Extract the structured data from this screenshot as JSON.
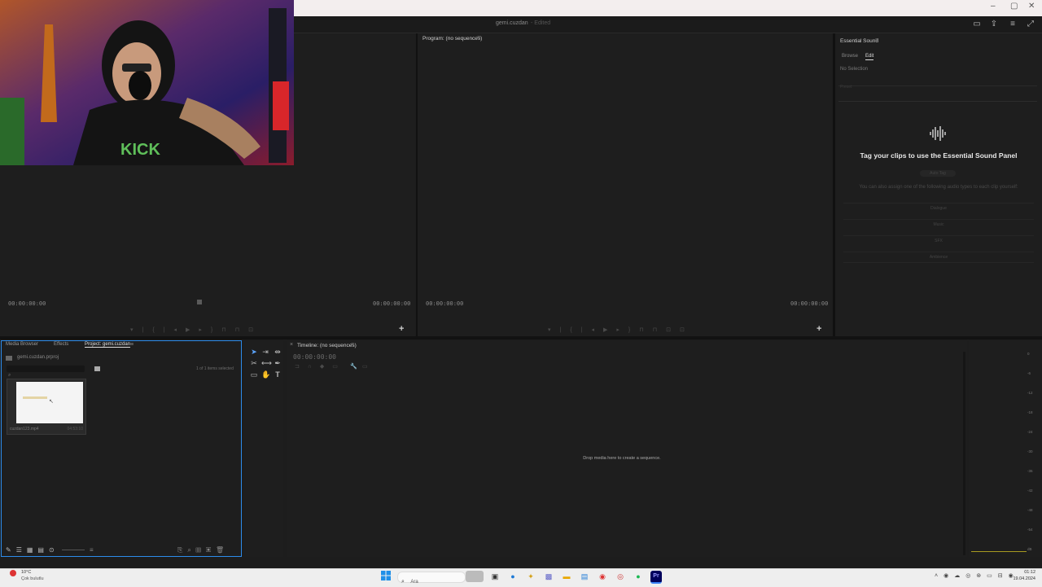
{
  "window": {
    "title": "gemi.cuzdan",
    "edited": "- Edited",
    "controls": [
      "–",
      "▢",
      "✕"
    ]
  },
  "header_icons": [
    "layout-icon",
    "share-icon",
    "menu-icon",
    "fullscreen-icon"
  ],
  "source_monitor": {
    "timecode_left": "00:00:00:00",
    "timecode_right": "00:00:00:00"
  },
  "program_monitor": {
    "title": "Program: (no sequences)",
    "timecode_left": "00:00:00:00",
    "timecode_right": "00:00:00:00"
  },
  "essential_sound": {
    "title": "Essential Sound",
    "tabs": [
      "Browse",
      "Edit"
    ],
    "active_tab": "Edit",
    "no_selection": "No Selection",
    "preset_placeholder": "Preset",
    "headline": "Tag your clips to use the Essential Sound Panel",
    "auto_tag": "Auto Tag",
    "info": "You can also assign one of the following audio types to each clip yourself:",
    "audio_types": [
      "Dialogue",
      "Music",
      "SFX",
      "Ambience"
    ]
  },
  "project_panel": {
    "tabs": [
      "Media Browser",
      "Effects",
      "Project: gemi.cuzdan"
    ],
    "active_tab": "Project: gemi.cuzdan",
    "file_name": "gemi.cuzdan.prproj",
    "selection_count": "1 of 1 items selected",
    "clip_name": "cuzdan123.mp4",
    "clip_duration": "04:53:10"
  },
  "timeline": {
    "title": "Timeline: (no sequences)",
    "timecode": "00:00:00:00",
    "drop_hint": "Drop media here to create a sequence."
  },
  "audio_meter": {
    "scale": [
      "0",
      "-6",
      "-12",
      "-18",
      "-24",
      "-30",
      "-36",
      "-42",
      "-48",
      "-54",
      "dB"
    ]
  },
  "taskbar": {
    "weather_temp": "10°C",
    "weather_desc": "Çok bulutlu",
    "search_placeholder": "Ara",
    "time": "01:12",
    "date": "19.04.2024"
  },
  "colors": {
    "accent": "#2d8ceb",
    "panel_bg": "#1e1e1e",
    "taskbar_bg": "#eeeeee"
  }
}
